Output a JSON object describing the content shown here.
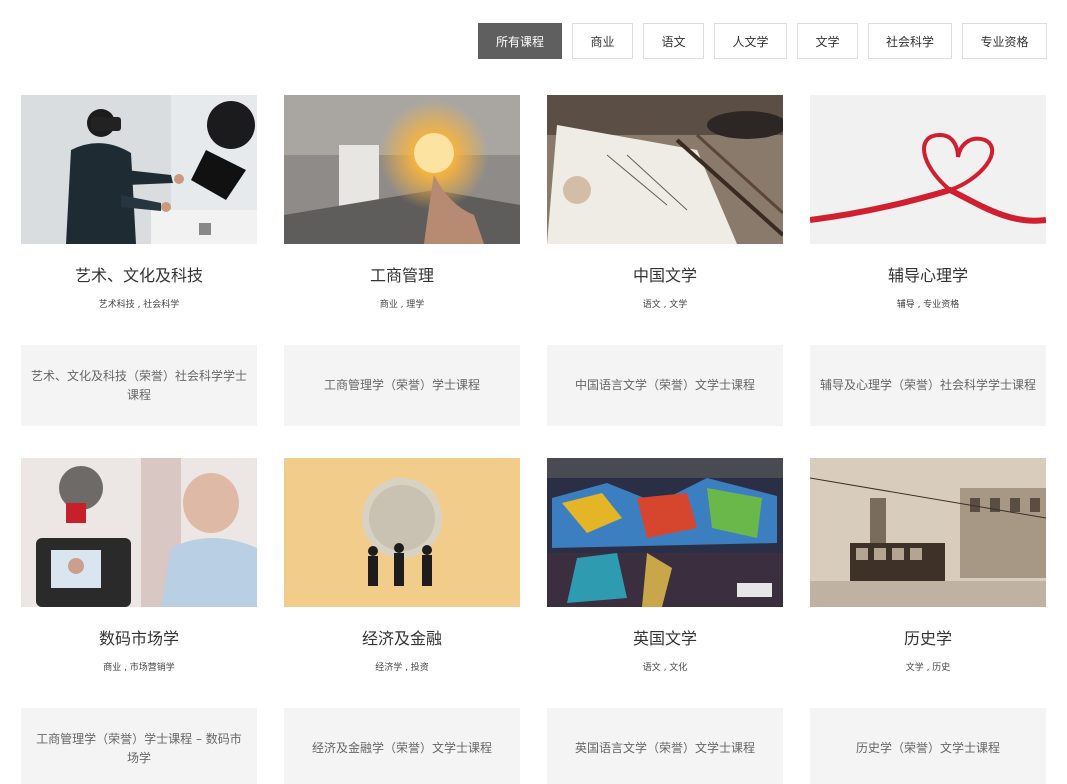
{
  "filters": [
    {
      "label": "所有课程",
      "active": true
    },
    {
      "label": "商业",
      "active": false
    },
    {
      "label": "语文",
      "active": false
    },
    {
      "label": "人文学",
      "active": false
    },
    {
      "label": "文学",
      "active": false
    },
    {
      "label": "社会科学",
      "active": false
    },
    {
      "label": "专业资格",
      "active": false
    }
  ],
  "courses": [
    {
      "title": "艺术、文化及科技",
      "tags": "艺术科技 , 社会科学",
      "course": "艺术、文化及科技（荣誉）社会科学学士课程",
      "image": "vr-headset-photo"
    },
    {
      "title": "工商管理",
      "tags": "商业 , 理学",
      "course": "工商管理学（荣誉）学士课程",
      "image": "lightbulb-photo"
    },
    {
      "title": "中国文学",
      "tags": "语文 , 文学",
      "course": "中国语言文学（荣誉）文学士课程",
      "image": "calligraphy-photo"
    },
    {
      "title": "辅导心理学",
      "tags": "辅导 , 专业资格",
      "course": "辅导及心理学（荣誉）社会科学学士课程",
      "image": "ribbon-heart-photo"
    },
    {
      "title": "数码市场学",
      "tags": "商业 , 市场营销学",
      "course": "工商管理学（荣誉）学士课程 – 数码市场学",
      "image": "vlogger-camera-photo"
    },
    {
      "title": "经济及金融",
      "tags": "经济学 , 投资",
      "course": "经济及金融学（荣誉）文学士课程",
      "image": "coin-figures-photo"
    },
    {
      "title": "英国文学",
      "tags": "语文 , 文化",
      "course": "英国语言文学（荣誉）文学士课程",
      "image": "graffiti-photo"
    },
    {
      "title": "历史学",
      "tags": "文学 , 历史",
      "course": "历史学（荣誉）文学士课程",
      "image": "tram-street-photo"
    }
  ]
}
